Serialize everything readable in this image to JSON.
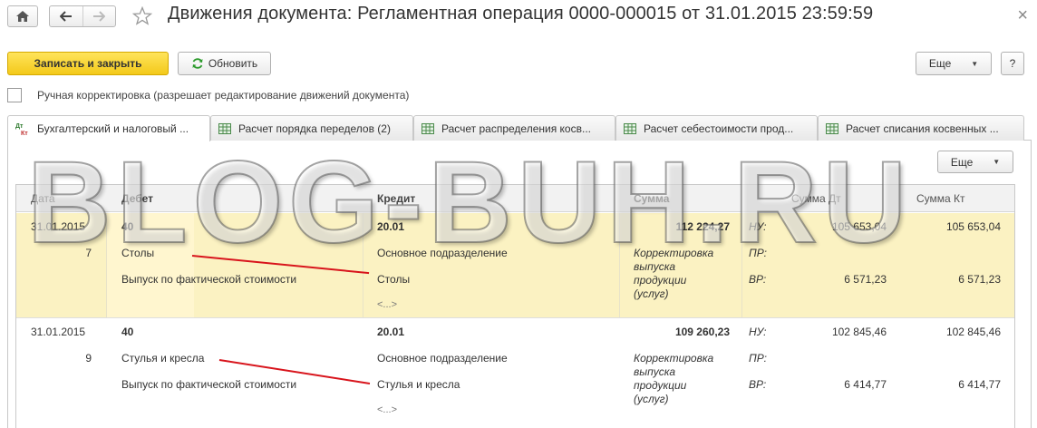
{
  "header": {
    "title": "Движения документа: Регламентная операция 0000-000015 от 31.01.2015 23:59:59",
    "close_symbol": "×"
  },
  "toolbar": {
    "save_close_label": "Записать и закрыть",
    "refresh_label": "Обновить",
    "more_label": "Еще",
    "help_label": "?"
  },
  "manual_checkbox": {
    "label": "Ручная корректировка (разрешает редактирование движений документа)",
    "checked": false
  },
  "tabs": [
    {
      "label": "Бухгалтерский и налоговый ...",
      "active": true
    },
    {
      "label": "Расчет порядка переделов (2)",
      "active": false
    },
    {
      "label": "Расчет распределения косв...",
      "active": false
    },
    {
      "label": "Расчет себестоимости прод...",
      "active": false
    },
    {
      "label": "Расчет списания косвенных ...",
      "active": false
    }
  ],
  "panel": {
    "more_label": "Еще"
  },
  "table": {
    "columns": {
      "date": "Дата",
      "debit": "Дебет",
      "credit": "Кредит",
      "amount": "Сумма",
      "amount_dt": "Сумма Дт",
      "amount_kt": "Сумма Кт"
    },
    "rows": [
      {
        "date": "31.01.2015",
        "number": "7",
        "debit_account": "40",
        "debit_sub1": "Столы",
        "debit_sub2": "Выпуск по фактической стоимости",
        "credit_account": "20.01",
        "credit_sub1": "Основное подразделение",
        "credit_sub2": "Столы",
        "credit_sub3": "<...>",
        "amount": "112 224,27",
        "content": "Корректировка выпуска продукции (услуг)",
        "label_nu": "НУ:",
        "label_pr": "ПР:",
        "label_vr": "ВР:",
        "nu_dt": "105 653,04",
        "nu_kt": "105 653,04",
        "vr_dt": "6 571,23",
        "vr_kt": "6 571,23",
        "selected": true
      },
      {
        "date": "31.01.2015",
        "number": "9",
        "debit_account": "40",
        "debit_sub1": "Стулья и кресла",
        "debit_sub2": "Выпуск по фактической стоимости",
        "credit_account": "20.01",
        "credit_sub1": "Основное подразделение",
        "credit_sub2": "Стулья и кресла",
        "credit_sub3": "<...>",
        "amount": "109 260,23",
        "content": "Корректировка выпуска продукции (услуг)",
        "label_nu": "НУ:",
        "label_pr": "ПР:",
        "label_vr": "ВР:",
        "nu_dt": "102 845,46",
        "nu_kt": "102 845,46",
        "vr_dt": "6 414,77",
        "vr_kt": "6 414,77",
        "selected": false
      }
    ]
  },
  "watermark": "BLOG-BUH.RU",
  "colors": {
    "accent_yellow": "#f3c91a",
    "selected_row": "#fbf2c2",
    "annotation_red": "#d8141c"
  }
}
